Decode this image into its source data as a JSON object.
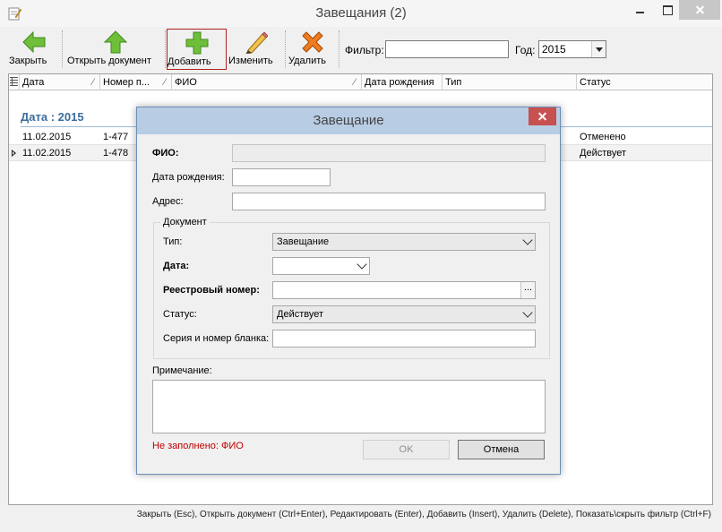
{
  "window": {
    "title": "Завещания (2)"
  },
  "toolbar": {
    "close_label": "Закрыть",
    "open_label": "Открыть документ",
    "add_label": "Добавить",
    "edit_label": "Изменить",
    "delete_label": "Удалить",
    "filter_label": "Фильтр:",
    "filter_value": "",
    "year_label": "Год:",
    "year_value": "2015"
  },
  "grid": {
    "columns": [
      "Дата",
      "Номер п...",
      "ФИО",
      "Дата рождения",
      "Тип",
      "Статус"
    ],
    "group_label": "Дата : 2015",
    "rows": [
      {
        "date": "11.02.2015",
        "number": "1-477",
        "status": "Отменено"
      },
      {
        "date": "11.02.2015",
        "number": "1-478",
        "status": "Действует"
      }
    ]
  },
  "statusbar": "Закрыть (Esc), Открыть документ (Ctrl+Enter), Редактировать (Enter), Добавить (Insert), Удалить (Delete), Показать\\скрыть фильтр (Ctrl+F)",
  "dialog": {
    "title": "Завещание",
    "fio_label": "ФИО:",
    "fio_value": "",
    "birth_label": "Дата рождения:",
    "birth_value": "",
    "address_label": "Адрес:",
    "address_value": "",
    "document_group": "Документ",
    "type_label": "Тип:",
    "type_value": "Завещание",
    "date_label": "Дата:",
    "date_value": "",
    "reg_label": "Реестровый номер:",
    "reg_value": "",
    "reg_button": "...",
    "status_label": "Статус:",
    "status_value": "Действует",
    "blank_label": "Серия и номер бланка:",
    "blank_value": "",
    "note_label": "Примечание:",
    "note_value": "",
    "warning": "Не заполнено: ФИО",
    "ok_label": "OK",
    "cancel_label": "Отмена"
  },
  "colors": {
    "group_header": "#3d6e9e",
    "dialog_titlebar": "#b8cde4",
    "dialog_close": "#c75050",
    "warning": "#c00000",
    "active_button_border": "#b22222"
  }
}
